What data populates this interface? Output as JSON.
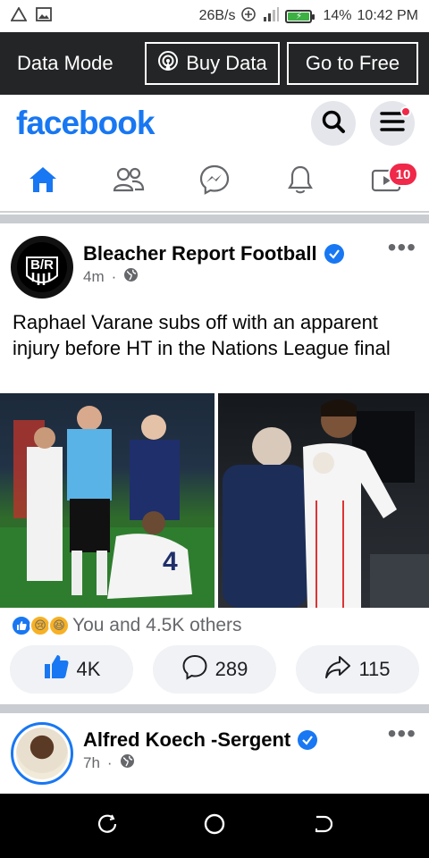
{
  "status_bar": {
    "net_speed": "26B/s",
    "battery": "14%",
    "time": "10:42 PM"
  },
  "data_bar": {
    "mode_label": "Data Mode",
    "buy_label": "Buy Data",
    "free_label": "Go to Free"
  },
  "header": {
    "logo": "facebook"
  },
  "nav": {
    "watch_badge": "10"
  },
  "post1": {
    "page_name": "Bleacher Report Football",
    "time": "4m",
    "text": "Raphael Varane subs off with an apparent injury before HT in the Nations League final",
    "reactions_text": "You and 4.5K others",
    "like_count": "4K",
    "comment_count": "289",
    "share_count": "115",
    "avatar_text": "B/R"
  },
  "post2": {
    "page_name": "Alfred Koech -Sergent",
    "time": "7h"
  },
  "colors": {
    "brand": "#1877f2",
    "badge": "#f02849"
  }
}
